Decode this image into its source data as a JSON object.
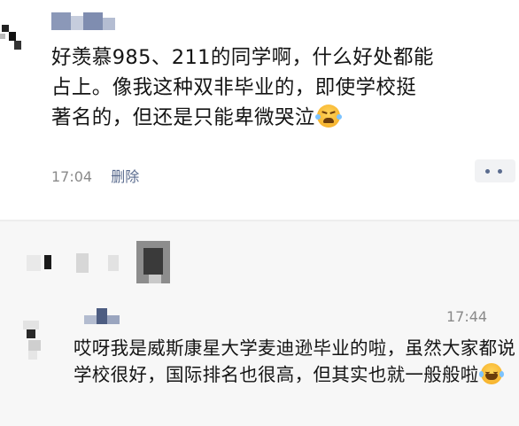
{
  "post": {
    "text": "好羡慕985、211的同学啊，什么好处都能\n占上。像我这种双非毕业的，即使学校挺\n著名的，但还是只能卑微哭泣",
    "time": "17:04",
    "delete_label": "删除",
    "emoji_icon": "crying-face-icon"
  },
  "comment": {
    "time": "17:44",
    "text": "哎呀我是威斯康星大学麦迪逊毕业的啦，虽然大家都说学校很好，国际排名也很高，但其实也就一般般啦",
    "emoji_icon": "tears-of-joy-icon"
  },
  "colors": {
    "link": "#5a6b8e",
    "meta_text": "#8a8a8a",
    "comment_bg": "#f7f7f7"
  }
}
